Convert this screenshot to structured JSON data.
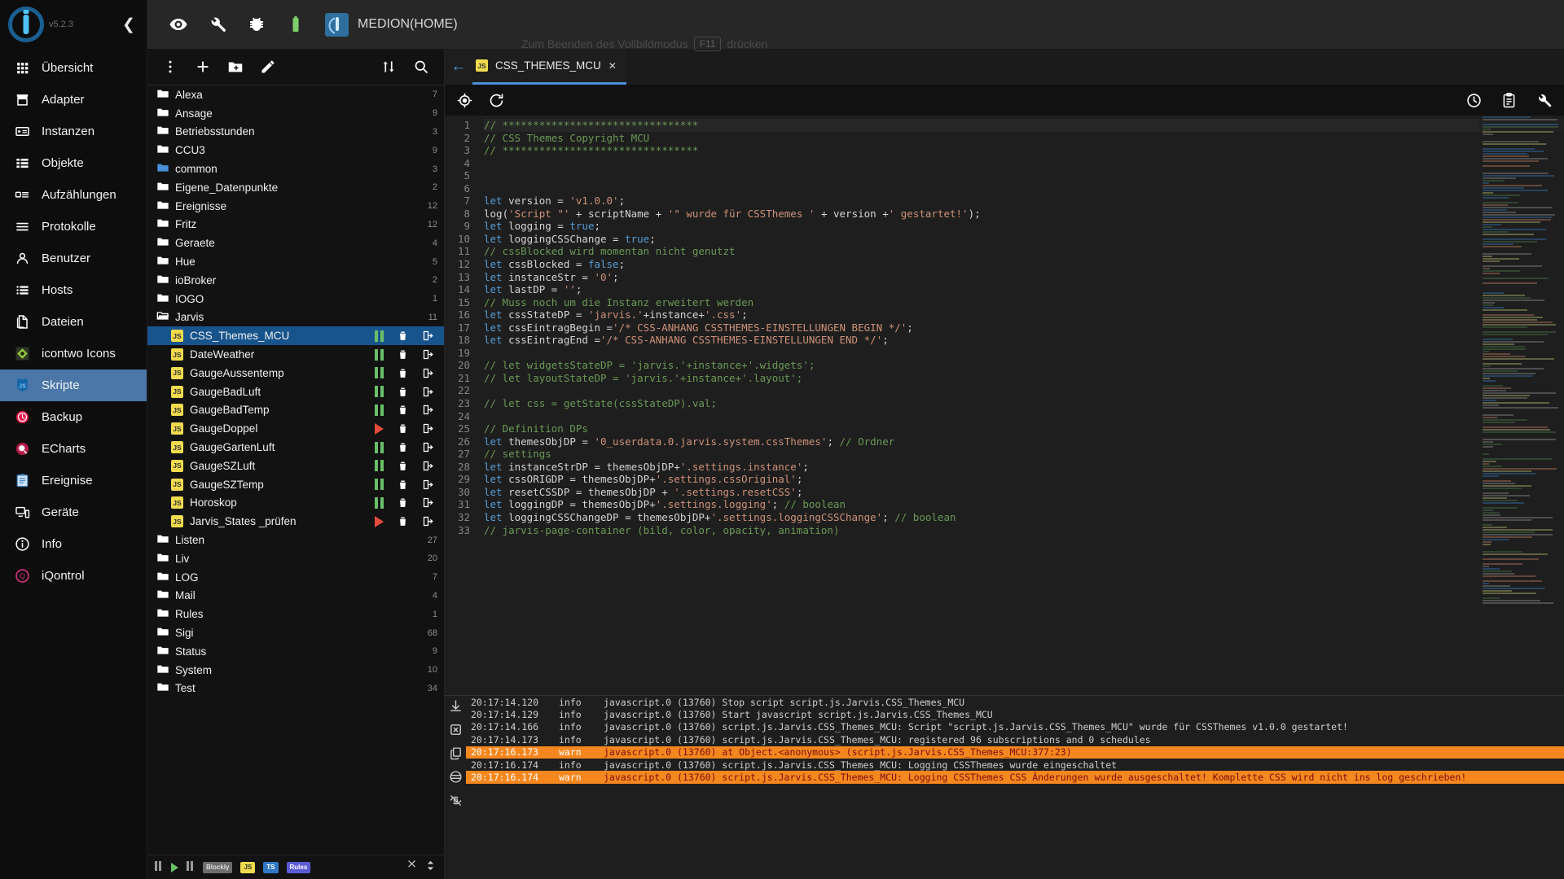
{
  "app": {
    "version": "v5.2.3",
    "host_name": "MEDION(HOME)",
    "fullscreen_hint_prefix": "Zum Beenden des Vollbildmodus",
    "fullscreen_hint_key": "F11",
    "fullscreen_hint_suffix": "drücken"
  },
  "topbar": {
    "buttons": [
      {
        "name": "eye-icon",
        "label": "Expertenmodus"
      },
      {
        "name": "wrench-icon",
        "label": "Einstellungen"
      },
      {
        "name": "bug-icon",
        "label": "Debug"
      },
      {
        "name": "battery-icon",
        "label": "Status"
      }
    ]
  },
  "sidebar": {
    "items": [
      {
        "label": "Übersicht",
        "icon": "grid-icon",
        "active": false
      },
      {
        "label": "Adapter",
        "icon": "store-icon",
        "active": false
      },
      {
        "label": "Instanzen",
        "icon": "instances-icon",
        "active": false
      },
      {
        "label": "Objekte",
        "icon": "list-icon",
        "active": false
      },
      {
        "label": "Aufzählungen",
        "icon": "enum-icon",
        "active": false
      },
      {
        "label": "Protokolle",
        "icon": "logs-icon",
        "active": false
      },
      {
        "label": "Benutzer",
        "icon": "user-icon",
        "active": false
      },
      {
        "label": "Hosts",
        "icon": "hosts-icon",
        "active": false
      },
      {
        "label": "Dateien",
        "icon": "files-icon",
        "active": false
      },
      {
        "label": "icontwo Icons",
        "icon": "icontwo-icon",
        "active": false
      },
      {
        "label": "Skripte",
        "icon": "js-icon",
        "active": true
      },
      {
        "label": "Backup",
        "icon": "backup-icon",
        "active": false
      },
      {
        "label": "ECharts",
        "icon": "echarts-icon",
        "active": false
      },
      {
        "label": "Ereignise",
        "icon": "events-icon",
        "active": false
      },
      {
        "label": "Geräte",
        "icon": "devices-icon",
        "active": false
      },
      {
        "label": "Info",
        "icon": "info-icon",
        "active": false
      },
      {
        "label": "iQontrol",
        "icon": "iqontrol-icon",
        "active": false
      }
    ]
  },
  "tree_toolbar": {
    "buttons": [
      {
        "name": "more-vert-icon",
        "label": "Mehr"
      },
      {
        "name": "add-script-icon",
        "label": "Neues Skript"
      },
      {
        "name": "add-folder-icon",
        "label": "Neuer Ordner"
      },
      {
        "name": "edit-icon",
        "label": "Umbenennen"
      },
      {
        "name": "sort-icon",
        "label": "Sortieren"
      },
      {
        "name": "search-icon",
        "label": "Suchen"
      }
    ]
  },
  "tree": {
    "rows": [
      {
        "type": "folder",
        "label": "Alexa",
        "count": "7",
        "indent": 0,
        "open": false,
        "highlight": false
      },
      {
        "type": "folder",
        "label": "Ansage",
        "count": "9",
        "indent": 0,
        "open": false,
        "highlight": false
      },
      {
        "type": "folder",
        "label": "Betriebsstunden",
        "count": "3",
        "indent": 0,
        "open": false,
        "highlight": false
      },
      {
        "type": "folder",
        "label": "CCU3",
        "count": "9",
        "indent": 0,
        "open": false,
        "highlight": false
      },
      {
        "type": "folder",
        "label": "common",
        "count": "3",
        "indent": 0,
        "open": false,
        "highlight": true
      },
      {
        "type": "folder",
        "label": "Eigene_Datenpunkte",
        "count": "2",
        "indent": 0,
        "open": false,
        "highlight": false
      },
      {
        "type": "folder",
        "label": "Ereignisse",
        "count": "12",
        "indent": 0,
        "open": false,
        "highlight": false
      },
      {
        "type": "folder",
        "label": "Fritz",
        "count": "12",
        "indent": 0,
        "open": false,
        "highlight": false
      },
      {
        "type": "folder",
        "label": "Geraete",
        "count": "4",
        "indent": 0,
        "open": false,
        "highlight": false
      },
      {
        "type": "folder",
        "label": "Hue",
        "count": "5",
        "indent": 0,
        "open": false,
        "highlight": false
      },
      {
        "type": "folder",
        "label": "ioBroker",
        "count": "2",
        "indent": 0,
        "open": false,
        "highlight": false
      },
      {
        "type": "folder",
        "label": "IOGO",
        "count": "1",
        "indent": 0,
        "open": false,
        "highlight": false
      },
      {
        "type": "folder",
        "label": "Jarvis",
        "count": "11",
        "indent": 0,
        "open": true,
        "highlight": false
      },
      {
        "type": "script",
        "label": "CSS_Themes_MCU",
        "state": "paused",
        "indent": 1,
        "selected": true
      },
      {
        "type": "script",
        "label": "DateWeather",
        "state": "paused",
        "indent": 1,
        "selected": false
      },
      {
        "type": "script",
        "label": "GaugeAussentemp",
        "state": "paused",
        "indent": 1,
        "selected": false
      },
      {
        "type": "script",
        "label": "GaugeBadLuft",
        "state": "paused",
        "indent": 1,
        "selected": false
      },
      {
        "type": "script",
        "label": "GaugeBadTemp",
        "state": "paused",
        "indent": 1,
        "selected": false
      },
      {
        "type": "script",
        "label": "GaugeDoppel",
        "state": "stopped",
        "indent": 1,
        "selected": false
      },
      {
        "type": "script",
        "label": "GaugeGartenLuft",
        "state": "paused",
        "indent": 1,
        "selected": false
      },
      {
        "type": "script",
        "label": "GaugeSZLuft",
        "state": "paused",
        "indent": 1,
        "selected": false
      },
      {
        "type": "script",
        "label": "GaugeSZTemp",
        "state": "paused",
        "indent": 1,
        "selected": false
      },
      {
        "type": "script",
        "label": "Horoskop",
        "state": "paused",
        "indent": 1,
        "selected": false
      },
      {
        "type": "script",
        "label": "Jarvis_States _prüfen",
        "state": "stopped",
        "indent": 1,
        "selected": false
      },
      {
        "type": "folder",
        "label": "Listen",
        "count": "27",
        "indent": 0,
        "open": false,
        "highlight": false
      },
      {
        "type": "folder",
        "label": "Liv",
        "count": "20",
        "indent": 0,
        "open": false,
        "highlight": false
      },
      {
        "type": "folder",
        "label": "LOG",
        "count": "7",
        "indent": 0,
        "open": false,
        "highlight": false
      },
      {
        "type": "folder",
        "label": "Mail",
        "count": "4",
        "indent": 0,
        "open": false,
        "highlight": false
      },
      {
        "type": "folder",
        "label": "Rules",
        "count": "1",
        "indent": 0,
        "open": false,
        "highlight": false
      },
      {
        "type": "folder",
        "label": "Sigi",
        "count": "68",
        "indent": 0,
        "open": false,
        "highlight": false
      },
      {
        "type": "folder",
        "label": "Status",
        "count": "9",
        "indent": 0,
        "open": false,
        "highlight": false
      },
      {
        "type": "folder",
        "label": "System",
        "count": "10",
        "indent": 0,
        "open": false,
        "highlight": false
      },
      {
        "type": "folder",
        "label": "Test",
        "count": "34",
        "indent": 0,
        "open": false,
        "highlight": false
      }
    ]
  },
  "tree_footer": {
    "chips": [
      "Blockly",
      "JS",
      "TS",
      "Rules"
    ]
  },
  "editor": {
    "tab_label": "CSS_THEMES_MCU",
    "tab_close": "✕",
    "toolbar_left": [
      {
        "name": "target-icon",
        "label": "Gehe zu Definition"
      },
      {
        "name": "refresh-icon",
        "label": "Neu laden"
      }
    ],
    "toolbar_right": [
      {
        "name": "history-icon",
        "label": "Verlauf"
      },
      {
        "name": "clipboard-icon",
        "label": "Zwischenablage"
      },
      {
        "name": "settings-icon",
        "label": "Einstellungen"
      }
    ],
    "first_line": 1,
    "lines": [
      [
        [
          "cm",
          "// ********************************"
        ]
      ],
      [
        [
          "cm",
          "// CSS Themes Copyright MCU"
        ]
      ],
      [
        [
          "cm",
          "// ********************************"
        ]
      ],
      [],
      [],
      [],
      [
        [
          "kw",
          "let"
        ],
        [
          "pl",
          " version = "
        ],
        [
          "st",
          "'v1.0.0'"
        ],
        [
          "pl",
          ";"
        ]
      ],
      [
        [
          "pl",
          "log("
        ],
        [
          "st",
          "'Script \"'"
        ],
        [
          "pl",
          " + scriptName + "
        ],
        [
          "st",
          "'\" wurde für CSSThemes '"
        ],
        [
          "pl",
          " + version +"
        ],
        [
          "st",
          "' gestartet!'"
        ],
        [
          "pl",
          ");"
        ]
      ],
      [
        [
          "kw",
          "let"
        ],
        [
          "pl",
          " logging = "
        ],
        [
          "kw",
          "true"
        ],
        [
          "pl",
          ";"
        ]
      ],
      [
        [
          "kw",
          "let"
        ],
        [
          "pl",
          " loggingCSSChange = "
        ],
        [
          "kw",
          "true"
        ],
        [
          "pl",
          ";"
        ]
      ],
      [
        [
          "cm",
          "// cssBlocked wird momentan nicht genutzt"
        ]
      ],
      [
        [
          "kw",
          "let"
        ],
        [
          "pl",
          " cssBlocked = "
        ],
        [
          "kw",
          "false"
        ],
        [
          "pl",
          ";"
        ]
      ],
      [
        [
          "kw",
          "let"
        ],
        [
          "pl",
          " instanceStr = "
        ],
        [
          "st",
          "'0'"
        ],
        [
          "pl",
          ";"
        ]
      ],
      [
        [
          "kw",
          "let"
        ],
        [
          "pl",
          " lastDP = "
        ],
        [
          "st",
          "''"
        ],
        [
          "pl",
          ";"
        ]
      ],
      [
        [
          "cm",
          "// Muss noch um die Instanz erweitert werden"
        ]
      ],
      [
        [
          "kw",
          "let"
        ],
        [
          "pl",
          " cssStateDP = "
        ],
        [
          "st",
          "'jarvis.'"
        ],
        [
          "pl",
          "+instance+"
        ],
        [
          "st",
          "'.css'"
        ],
        [
          "pl",
          ";"
        ]
      ],
      [
        [
          "kw",
          "let"
        ],
        [
          "pl",
          " cssEintragBegin ="
        ],
        [
          "st",
          "'/* CSS-ANHANG CSSTHEMES-EINSTELLUNGEN BEGIN */'"
        ],
        [
          "pl",
          ";"
        ]
      ],
      [
        [
          "kw",
          "let"
        ],
        [
          "pl",
          " cssEintragEnd ="
        ],
        [
          "st",
          "'/* CSS-ANHANG CSSTHEMES-EINSTELLUNGEN END */'"
        ],
        [
          "pl",
          ";"
        ]
      ],
      [],
      [
        [
          "cm",
          "// let widgetsStateDP = 'jarvis.'+instance+'.widgets';"
        ]
      ],
      [
        [
          "cm",
          "// let layoutStateDP = 'jarvis.'+instance+'.layout';"
        ]
      ],
      [],
      [
        [
          "cm",
          "// let css = getState(cssStateDP).val;"
        ]
      ],
      [],
      [
        [
          "cm",
          "// Definition DPs"
        ]
      ],
      [
        [
          "kw",
          "let"
        ],
        [
          "pl",
          " themesObjDP = "
        ],
        [
          "st",
          "'0_userdata.0.jarvis.system.cssThemes'"
        ],
        [
          "pl",
          "; "
        ],
        [
          "cm",
          "// Ordner"
        ]
      ],
      [
        [
          "cm",
          "// settings"
        ]
      ],
      [
        [
          "kw",
          "let"
        ],
        [
          "pl",
          " instanceStrDP = themesObjDP+"
        ],
        [
          "st",
          "'.settings.instance'"
        ],
        [
          "pl",
          ";"
        ]
      ],
      [
        [
          "kw",
          "let"
        ],
        [
          "pl",
          " cssORIGDP = themesObjDP+"
        ],
        [
          "st",
          "'.settings.cssOriginal'"
        ],
        [
          "pl",
          ";"
        ]
      ],
      [
        [
          "kw",
          "let"
        ],
        [
          "pl",
          " resetCSSDP = themesObjDP + "
        ],
        [
          "st",
          "'.settings.resetCSS'"
        ],
        [
          "pl",
          ";"
        ]
      ],
      [
        [
          "kw",
          "let"
        ],
        [
          "pl",
          " loggingDP = themesObjDP+"
        ],
        [
          "st",
          "'.settings.logging'"
        ],
        [
          "pl",
          "; "
        ],
        [
          "cm",
          "// boolean"
        ]
      ],
      [
        [
          "kw",
          "let"
        ],
        [
          "pl",
          " loggingCSSChangeDP = themesObjDP+"
        ],
        [
          "st",
          "'.settings.loggingCSSChange'"
        ],
        [
          "pl",
          "; "
        ],
        [
          "cm",
          "// boolean"
        ]
      ],
      [
        [
          "cm",
          "// jarvis-page-container (bild, color, opacity, animation)"
        ]
      ]
    ]
  },
  "log_panel": {
    "side_buttons": [
      {
        "name": "download-icon",
        "label": "Herunterladen"
      },
      {
        "name": "clear-log-icon",
        "label": "Log leeren"
      },
      {
        "name": "copy-icon",
        "label": "Kopieren"
      },
      {
        "name": "filter-icon",
        "label": "Filter"
      },
      {
        "name": "hide-icon",
        "label": "Log ausblenden"
      }
    ],
    "rows": [
      {
        "time": "20:17:14.120",
        "severity": "info",
        "message": "javascript.0 (13760) Stop script script.js.Jarvis.CSS_Themes_MCU"
      },
      {
        "time": "20:17:14.129",
        "severity": "info",
        "message": "javascript.0 (13760) Start javascript script.js.Jarvis.CSS_Themes_MCU"
      },
      {
        "time": "20:17:14.166",
        "severity": "info",
        "message": "javascript.0 (13760) script.js.Jarvis.CSS_Themes_MCU: Script \"script.js.Jarvis.CSS_Themes_MCU\" wurde für CSSThemes v1.0.0 gestartet!"
      },
      {
        "time": "20:17:14.173",
        "severity": "info",
        "message": "javascript.0 (13760) script.js.Jarvis.CSS_Themes_MCU: registered 96 subscriptions and 0 schedules"
      },
      {
        "time": "20:17:16.173",
        "severity": "warn",
        "message": "javascript.0 (13760) at Object.<anonymous> (script.js.Jarvis.CSS_Themes_MCU:377:23)"
      },
      {
        "time": "20:17:16.174",
        "severity": "info",
        "message": "javascript.0 (13760) script.js.Jarvis.CSS_Themes_MCU: Logging CSSThemes wurde eingeschaltet"
      },
      {
        "time": "20:17:16.174",
        "severity": "warn",
        "message": "javascript.0 (13760) script.js.Jarvis.CSS_Themes_MCU: Logging CSSThemes CSS Änderungen wurde ausgeschaltet! Komplette CSS wird nicht ins log geschrieben!"
      }
    ]
  },
  "colors": {
    "accent": "#4a90d9",
    "sidebar_active": "#4a77a8",
    "tree_selected": "#18548c",
    "warn": "#f5871f",
    "js_yellow": "#f0db4f",
    "run_green": "#6abf69",
    "stop_red": "#e54b3c"
  }
}
